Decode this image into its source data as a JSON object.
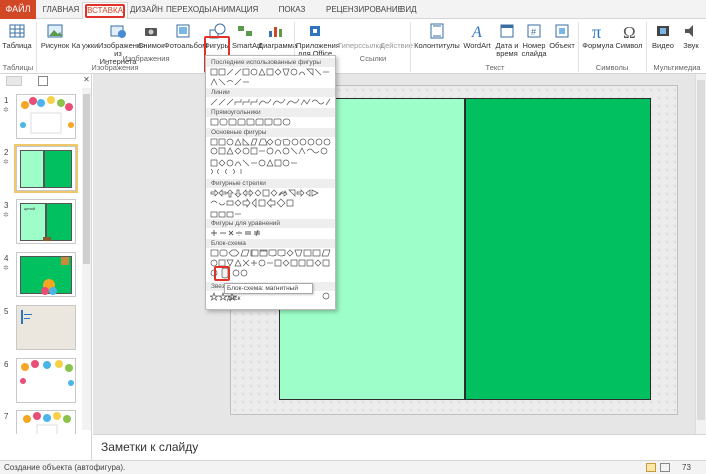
{
  "tabs": {
    "file": "ФАЙЛ",
    "items": [
      "ГЛАВНАЯ",
      "ВСТАВКА",
      "ДИЗАЙН",
      "ПЕРЕХОДЫ",
      "АНИМАЦИЯ",
      "ПОКАЗ СЛАЙДОВ",
      "РЕЦЕНЗИРОВАНИЕ",
      "ВИД"
    ]
  },
  "ribbon": {
    "table": "Таблица",
    "picture": "Рисунок",
    "pic_frag": "Ка",
    "online_1": "ужки",
    "online_2": "Изображения",
    "online_3": "из Интернета",
    "screenshot": "Снимок",
    "album": "Фотоальбом",
    "shapes": "Фигуры",
    "smartart": "SmartArt",
    "chart": "Диаграмма",
    "apps_1": "Приложения",
    "apps_2": "для Office",
    "hyperlink": "Гиперссылка",
    "action": "Действие",
    "header": "Колонтитулы",
    "wordart": "WordArt",
    "datetime_1": "Дата и",
    "datetime_2": "время",
    "slidenum_1": "Номер",
    "slidenum_2": "слайда",
    "object": "Объект",
    "formula": "Формула",
    "symbol": "Символ",
    "video": "Видео",
    "audio": "Звук",
    "groups": {
      "tables": "Таблицы",
      "images": "Изображения",
      "images_sub": "Изображения",
      "links": "Ссылки",
      "text": "Текст",
      "symbols": "Символы",
      "multimedia": "Мультимедиа"
    }
  },
  "gallery": {
    "sections": [
      "Последние использованные фигуры",
      "Линии",
      "Прямоугольники",
      "Основные фигуры",
      "Фигурные стрелки",
      "Фигуры для уравнений",
      "Блок-схема",
      "Звезды и ленты"
    ],
    "tooltip": "Блок-схема: магнитный диск"
  },
  "thumbnails": [
    {
      "num": "1",
      "has_star": true
    },
    {
      "num": "2",
      "has_star": true
    },
    {
      "num": "3",
      "has_star": true,
      "text": "ценой"
    },
    {
      "num": "4",
      "has_star": true
    },
    {
      "num": "5",
      "has_star": false
    },
    {
      "num": "6",
      "has_star": false
    },
    {
      "num": "7",
      "has_star": false
    }
  ],
  "notes": {
    "placeholder": "Заметки к слайду"
  },
  "status": {
    "text": "Создание объекта (автофигура).",
    "zoom": "73"
  },
  "colors": {
    "accent": "#d24726",
    "light_green": "#9dfec9",
    "green": "#00c060",
    "highlight": "#e1322a"
  }
}
